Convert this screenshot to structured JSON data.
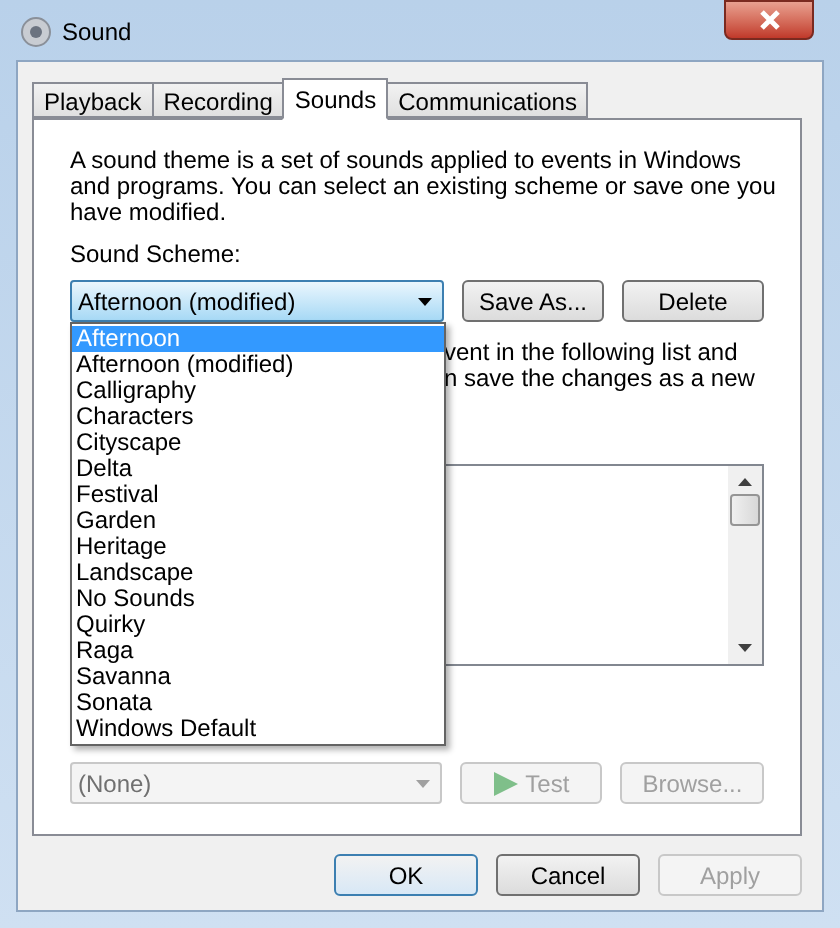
{
  "window": {
    "title": "Sound"
  },
  "tabs": [
    {
      "label": "Playback",
      "selected": false
    },
    {
      "label": "Recording",
      "selected": false
    },
    {
      "label": "Sounds",
      "selected": true
    },
    {
      "label": "Communications",
      "selected": false
    }
  ],
  "description": "A sound theme is a set of sounds applied to events in Windows and programs.  You can select an existing scheme or save one you have modified.",
  "scheme_label": "Sound Scheme:",
  "scheme_select": {
    "value": "Afternoon (modified)",
    "expanded": true,
    "options": [
      {
        "label": "Afternoon",
        "highlighted": true
      },
      {
        "label": "Afternoon (modified)",
        "highlighted": false
      },
      {
        "label": "Calligraphy",
        "highlighted": false
      },
      {
        "label": "Characters",
        "highlighted": false
      },
      {
        "label": "Cityscape",
        "highlighted": false
      },
      {
        "label": "Delta",
        "highlighted": false
      },
      {
        "label": "Festival",
        "highlighted": false
      },
      {
        "label": "Garden",
        "highlighted": false
      },
      {
        "label": "Heritage",
        "highlighted": false
      },
      {
        "label": "Landscape",
        "highlighted": false
      },
      {
        "label": "No Sounds",
        "highlighted": false
      },
      {
        "label": "Quirky",
        "highlighted": false
      },
      {
        "label": "Raga",
        "highlighted": false
      },
      {
        "label": "Savanna",
        "highlighted": false
      },
      {
        "label": "Sonata",
        "highlighted": false
      },
      {
        "label": "Windows Default",
        "highlighted": false
      }
    ]
  },
  "scheme_buttons": [
    {
      "label": "Save As...",
      "disabled": false
    },
    {
      "label": "Delete",
      "disabled": false
    }
  ],
  "hidden_text_lines": [
    "vent in the following list and",
    "n save the changes as a new"
  ],
  "sound_select": {
    "value": "(None)",
    "disabled": true
  },
  "sound_buttons": [
    {
      "label": "Test",
      "kind": "play",
      "disabled": true
    },
    {
      "label": "Browse...",
      "kind": "plain",
      "disabled": true
    }
  ],
  "footer_buttons": [
    {
      "label": "OK",
      "default": true,
      "disabled": false
    },
    {
      "label": "Cancel",
      "default": false,
      "disabled": false
    },
    {
      "label": "Apply",
      "default": false,
      "disabled": true
    }
  ]
}
